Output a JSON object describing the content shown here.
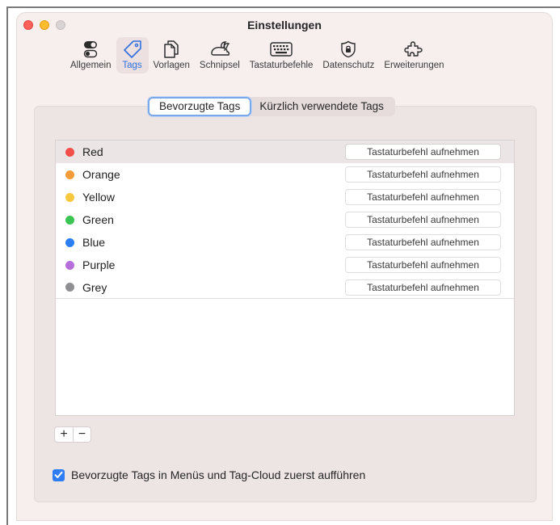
{
  "window": {
    "title": "Einstellungen"
  },
  "toolbar": {
    "items": [
      {
        "label": "Allgemein",
        "icon": "toggles-icon"
      },
      {
        "label": "Tags",
        "icon": "tag-icon",
        "active": true
      },
      {
        "label": "Vorlagen",
        "icon": "documents-icon"
      },
      {
        "label": "Schnipsel",
        "icon": "rabbit-icon"
      },
      {
        "label": "Tastaturbefehle",
        "icon": "keyboard-icon"
      },
      {
        "label": "Datenschutz",
        "icon": "lock-icon"
      },
      {
        "label": "Erweiterungen",
        "icon": "puzzle-icon"
      }
    ],
    "accent_color": "#2f6fdf"
  },
  "segments": {
    "favorites": "Bevorzugte Tags",
    "recent": "Kürzlich verwendete Tags"
  },
  "tags": [
    {
      "name": "Red",
      "color": "#f24f4b",
      "shortcut": "Tastaturbefehl aufnehmen"
    },
    {
      "name": "Orange",
      "color": "#f79a38",
      "shortcut": "Tastaturbefehl aufnehmen"
    },
    {
      "name": "Yellow",
      "color": "#f8c940",
      "shortcut": "Tastaturbefehl aufnehmen"
    },
    {
      "name": "Green",
      "color": "#3bc552",
      "shortcut": "Tastaturbefehl aufnehmen"
    },
    {
      "name": "Blue",
      "color": "#2c7ff2",
      "shortcut": "Tastaturbefehl aufnehmen"
    },
    {
      "name": "Purple",
      "color": "#b66fda",
      "shortcut": "Tastaturbefehl aufnehmen"
    },
    {
      "name": "Grey",
      "color": "#8e8e93",
      "shortcut": "Tastaturbefehl aufnehmen"
    }
  ],
  "list_controls": {
    "add": "+",
    "remove": "−"
  },
  "option": {
    "checked": true,
    "label": "Bevorzugte Tags in Menüs und Tag-Cloud zuerst aufführen"
  }
}
